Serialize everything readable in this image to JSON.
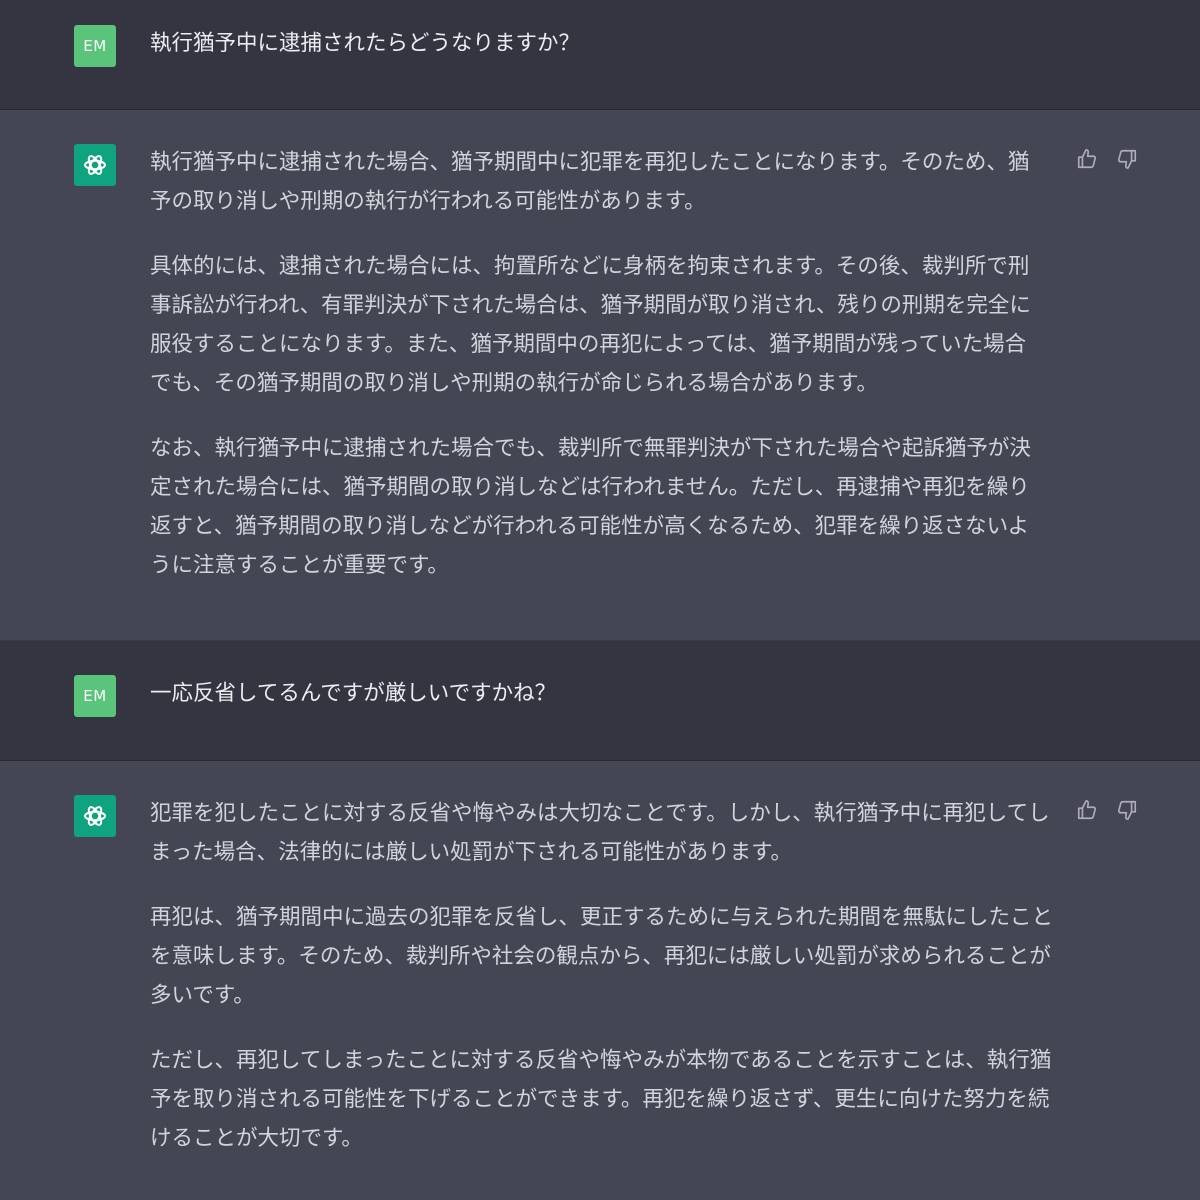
{
  "conversation": [
    {
      "role": "user",
      "avatar_label": "EM",
      "paragraphs": [
        "執行猶予中に逮捕されたらどうなりますか？"
      ]
    },
    {
      "role": "assistant",
      "avatar_icon": "chatgpt-logo-icon",
      "paragraphs": [
        "執行猶予中に逮捕された場合、猶予期間中に犯罪を再犯したことになります。そのため、猶予の取り消しや刑期の執行が行われる可能性があります。",
        "具体的には、逮捕された場合には、拘置所などに身柄を拘束されます。その後、裁判所で刑事訴訟が行われ、有罪判決が下された場合は、猶予期間が取り消され、残りの刑期を完全に服役することになります。また、猶予期間中の再犯によっては、猶予期間が残っていた場合でも、その猶予期間の取り消しや刑期の執行が命じられる場合があります。",
        "なお、執行猶予中に逮捕された場合でも、裁判所で無罪判決が下された場合や起訴猶予が決定された場合には、猶予期間の取り消しなどは行われません。ただし、再逮捕や再犯を繰り返すと、猶予期間の取り消しなどが行われる可能性が高くなるため、犯罪を繰り返さないように注意することが重要です。"
      ]
    },
    {
      "role": "user",
      "avatar_label": "EM",
      "paragraphs": [
        "一応反省してるんですが厳しいですかね？"
      ]
    },
    {
      "role": "assistant",
      "avatar_icon": "chatgpt-logo-icon",
      "paragraphs": [
        "犯罪を犯したことに対する反省や悔やみは大切なことです。しかし、執行猶予中に再犯してしまった場合、法律的には厳しい処罰が下される可能性があります。",
        "再犯は、猶予期間中に過去の犯罪を反省し、更正するために与えられた期間を無駄にしたことを意味します。そのため、裁判所や社会の観点から、再犯には厳しい処罰が求められることが多いです。",
        "ただし、再犯してしまったことに対する反省や悔やみが本物であることを示すことは、執行猶予を取り消される可能性を下げることができます。再犯を繰り返さず、更生に向けた努力を続けることが大切です。"
      ]
    }
  ],
  "colors": {
    "user_bg": "#343541",
    "assistant_bg": "#444654",
    "user_avatar": "#5ac47a",
    "bot_avatar": "#10a37f"
  }
}
